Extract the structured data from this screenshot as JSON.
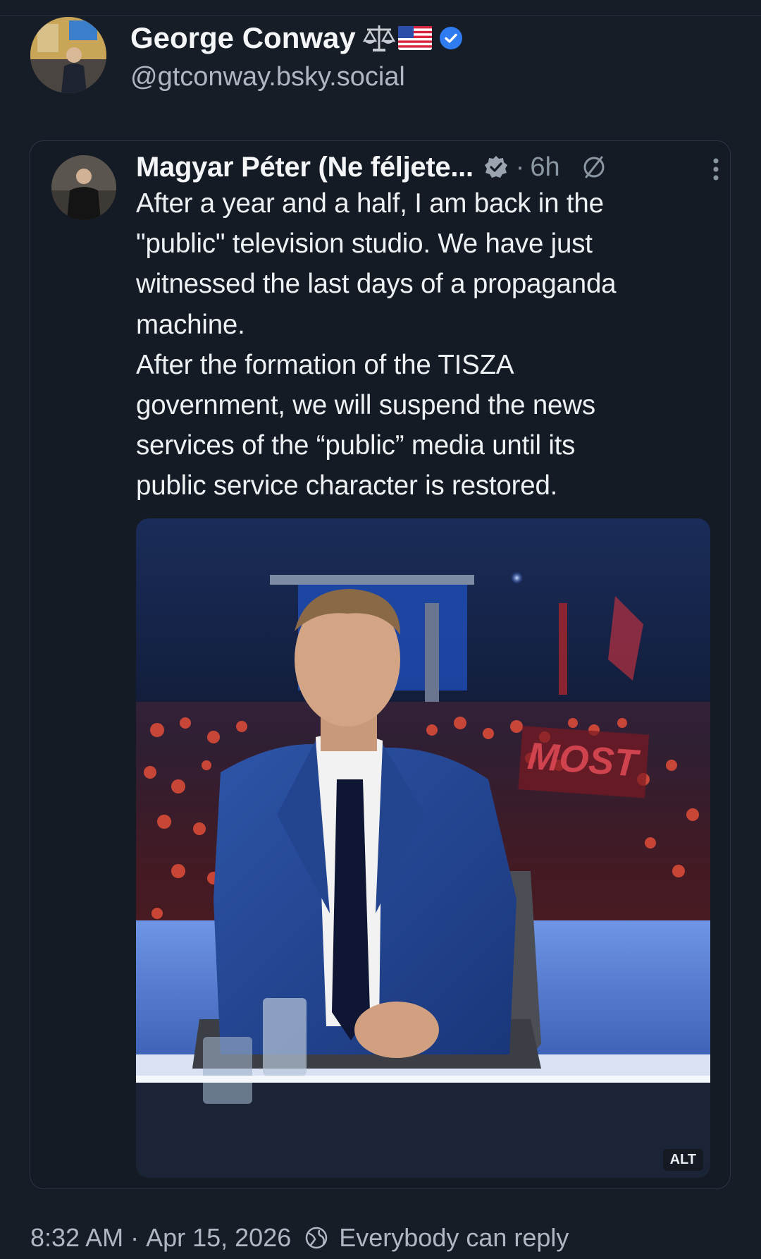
{
  "post": {
    "author_name": "George Conway",
    "author_emojis": [
      "scales-emoji",
      "us-flag-emoji"
    ],
    "author_handle": "@gtconway.bsky.social",
    "timestamp": "8:32 AM",
    "date": "Apr 15, 2026",
    "separator": "·",
    "reply_setting": "Everybody can reply"
  },
  "quote": {
    "author_name": "Magyar Péter (Ne féljete...",
    "dot": "·",
    "age": "6h",
    "text": "After a year and a half, I am back in the\n\"public\" television studio. We have just\nwitnessed the last days of a propaganda\nmachine.\nAfter the formation of the TISZA\ngovernment, we will suspend the news\nservices of the “public” media until its\npublic service character is restored.",
    "image_alt_label": "ALT",
    "image_background_sign": "MOST"
  },
  "icons": {
    "verified": "verified-badge-icon",
    "quote_verified": "verified-badge-icon",
    "mute": "mute-icon",
    "more": "more-vertical-icon",
    "reply_scope": "globe-reply-icon"
  },
  "colors": {
    "background": "#161d27",
    "verified_blue": "#2f7bf0",
    "muted_text": "#aeb7c2",
    "card_border": "#2c3644"
  }
}
